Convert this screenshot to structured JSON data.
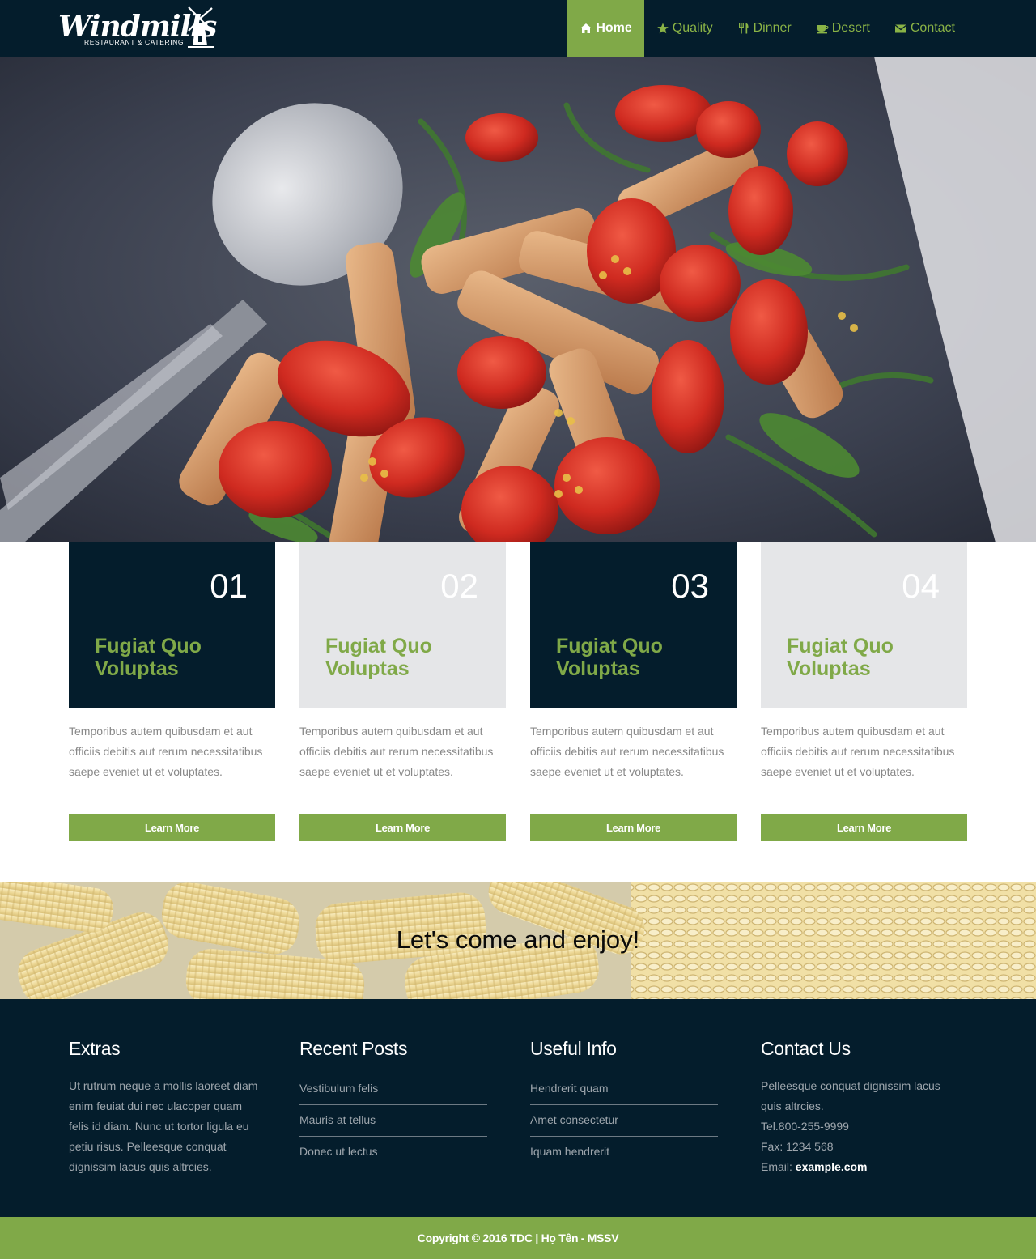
{
  "brand": {
    "name": "Windmills",
    "tagline": "RESTAURANT & CATERING"
  },
  "nav": {
    "items": [
      {
        "label": "Home",
        "icon": "home-icon"
      },
      {
        "label": "Quality",
        "icon": "star-icon"
      },
      {
        "label": "Dinner",
        "icon": "cutlery-icon"
      },
      {
        "label": "Desert",
        "icon": "cup-icon"
      },
      {
        "label": "Contact",
        "icon": "envelope-icon"
      }
    ],
    "active": "Home"
  },
  "features": [
    {
      "number": "01",
      "title": "Fugiat Quo Voluptas",
      "text": "Temporibus autem quibusdam et aut officiis debitis aut rerum necessitatibus saepe eveniet ut et voluptates.",
      "button": "Learn More",
      "style": "dark"
    },
    {
      "number": "02",
      "title": "Fugiat Quo Voluptas",
      "text": "Temporibus autem quibusdam et aut officiis debitis aut rerum necessitatibus saepe eveniet ut et voluptates.",
      "button": "Learn More",
      "style": "light"
    },
    {
      "number": "03",
      "title": "Fugiat Quo Voluptas",
      "text": "Temporibus autem quibusdam et aut officiis debitis aut rerum necessitatibus saepe eveniet ut et voluptates.",
      "button": "Learn More",
      "style": "dark"
    },
    {
      "number": "04",
      "title": "Fugiat Quo Voluptas",
      "text": "Temporibus autem quibusdam et aut officiis debitis aut rerum necessitatibus saepe eveniet ut et voluptates.",
      "button": "Learn More",
      "style": "light"
    }
  ],
  "banner": {
    "text": "Let's come and enjoy!"
  },
  "footer": {
    "extras": {
      "title": "Extras",
      "text": "Ut rutrum neque a mollis laoreet diam enim feuiat dui nec ulacoper quam felis id diam. Nunc ut tortor ligula eu petiu risus. Pelleesque conquat dignissim lacus quis altrcies."
    },
    "recent_posts": {
      "title": "Recent Posts",
      "items": [
        "Vestibulum felis",
        "Mauris at tellus",
        "Donec ut lectus"
      ]
    },
    "useful_info": {
      "title": "Useful Info",
      "items": [
        "Hendrerit quam",
        "Amet consectetur",
        "Iquam hendrerit"
      ]
    },
    "contact": {
      "title": "Contact Us",
      "text": "Pelleesque conquat dignissim lacus quis altrcies.",
      "tel": "Tel.800-255-9999",
      "fax": "Fax: 1234 568",
      "email_label": "Email:",
      "email": "example.com"
    }
  },
  "copyright": "Copyright © 2016 TDC | Họ Tên - MSSV",
  "colors": {
    "navy": "#041d2c",
    "green": "#80a948",
    "light_gray": "#e5e6e8"
  }
}
